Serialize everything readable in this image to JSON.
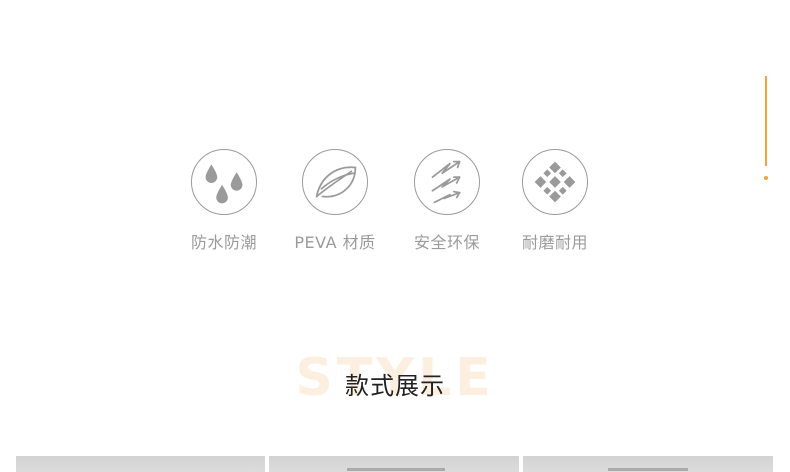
{
  "features": [
    {
      "icon": "water-drops-icon",
      "label": "防水防潮"
    },
    {
      "icon": "leaf-icon",
      "label": "PEVA 材质"
    },
    {
      "icon": "wind-arrows-icon",
      "label": "安全环保"
    },
    {
      "icon": "diamond-cluster-icon",
      "label": "耐磨耐用"
    }
  ],
  "section": {
    "bg_text": "STYLE",
    "title": "款式展示"
  },
  "colors": {
    "accent": "#f0a33a",
    "icon_gray": "#9a9a9a",
    "label_gray": "#9b9b9b",
    "title": "#222222",
    "bg_text": "#fcefe0"
  }
}
